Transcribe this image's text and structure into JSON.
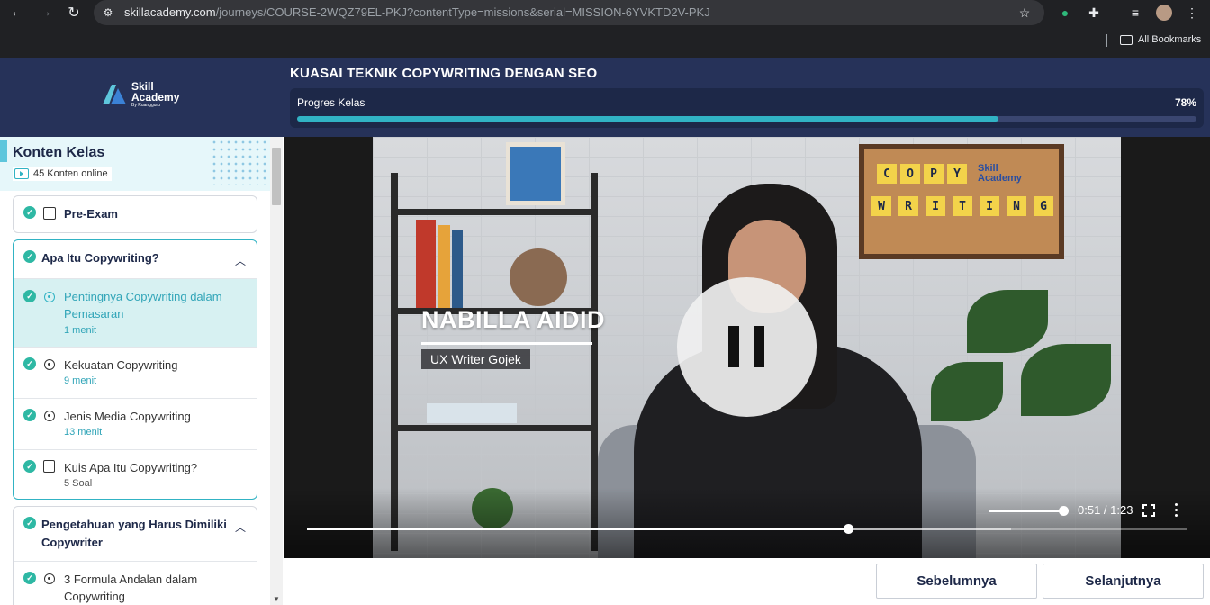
{
  "browser": {
    "url_domain": "skillacademy.com",
    "url_path": "/journeys/COURSE-2WQZ79EL-PKJ?contentType=missions&serial=MISSION-6YVKTD2V-PKJ",
    "bookmarks_label": "All Bookmarks"
  },
  "header": {
    "logo_line1": "Skill",
    "logo_line2": "Academy",
    "logo_sub": "By Ruangguru",
    "course_title": "KUASAI TEKNIK COPYWRITING DENGAN SEO",
    "progress_label": "Progres Kelas",
    "progress_pct_text": "78%",
    "progress_value": 0.78
  },
  "sidebar": {
    "title": "Konten Kelas",
    "online_text": "45 Konten online",
    "pre_exam": "Pre-Exam",
    "section1": {
      "title": "Apa Itu Copywriting?",
      "items": [
        {
          "title": "Pentingnya Copywriting dalam Pemasaran",
          "sub": "1 menit"
        },
        {
          "title": "Kekuatan Copywriting",
          "sub": "9 menit"
        },
        {
          "title": "Jenis Media Copywriting",
          "sub": "13 menit"
        },
        {
          "title": "Kuis Apa Itu Copywriting?",
          "sub": "5 Soal"
        }
      ]
    },
    "section2": {
      "title": "Pengetahuan yang Harus Dimiliki Copywriter",
      "items": [
        {
          "title": "3 Formula Andalan dalam Copywriting"
        }
      ]
    }
  },
  "video": {
    "board_letters_row1": [
      "C",
      "O",
      "P",
      "Y"
    ],
    "board_letters_row2": [
      "W",
      "R",
      "I",
      "T",
      "I",
      "N",
      "G"
    ],
    "board_logo_line1": "Skill",
    "board_logo_line2": "Academy",
    "name_caption": "NABILLA AIDID",
    "role_caption": "UX Writer Gojek",
    "time_text": "0:51 / 1:23",
    "played_fraction": 0.615,
    "buffered_fraction": 0.8
  },
  "nav": {
    "prev_label": "Sebelumnya",
    "next_label": "Selanjutnya"
  },
  "colors": {
    "header_bg": "#263259",
    "accent": "#31b3c4",
    "check": "#2eb8a4"
  }
}
